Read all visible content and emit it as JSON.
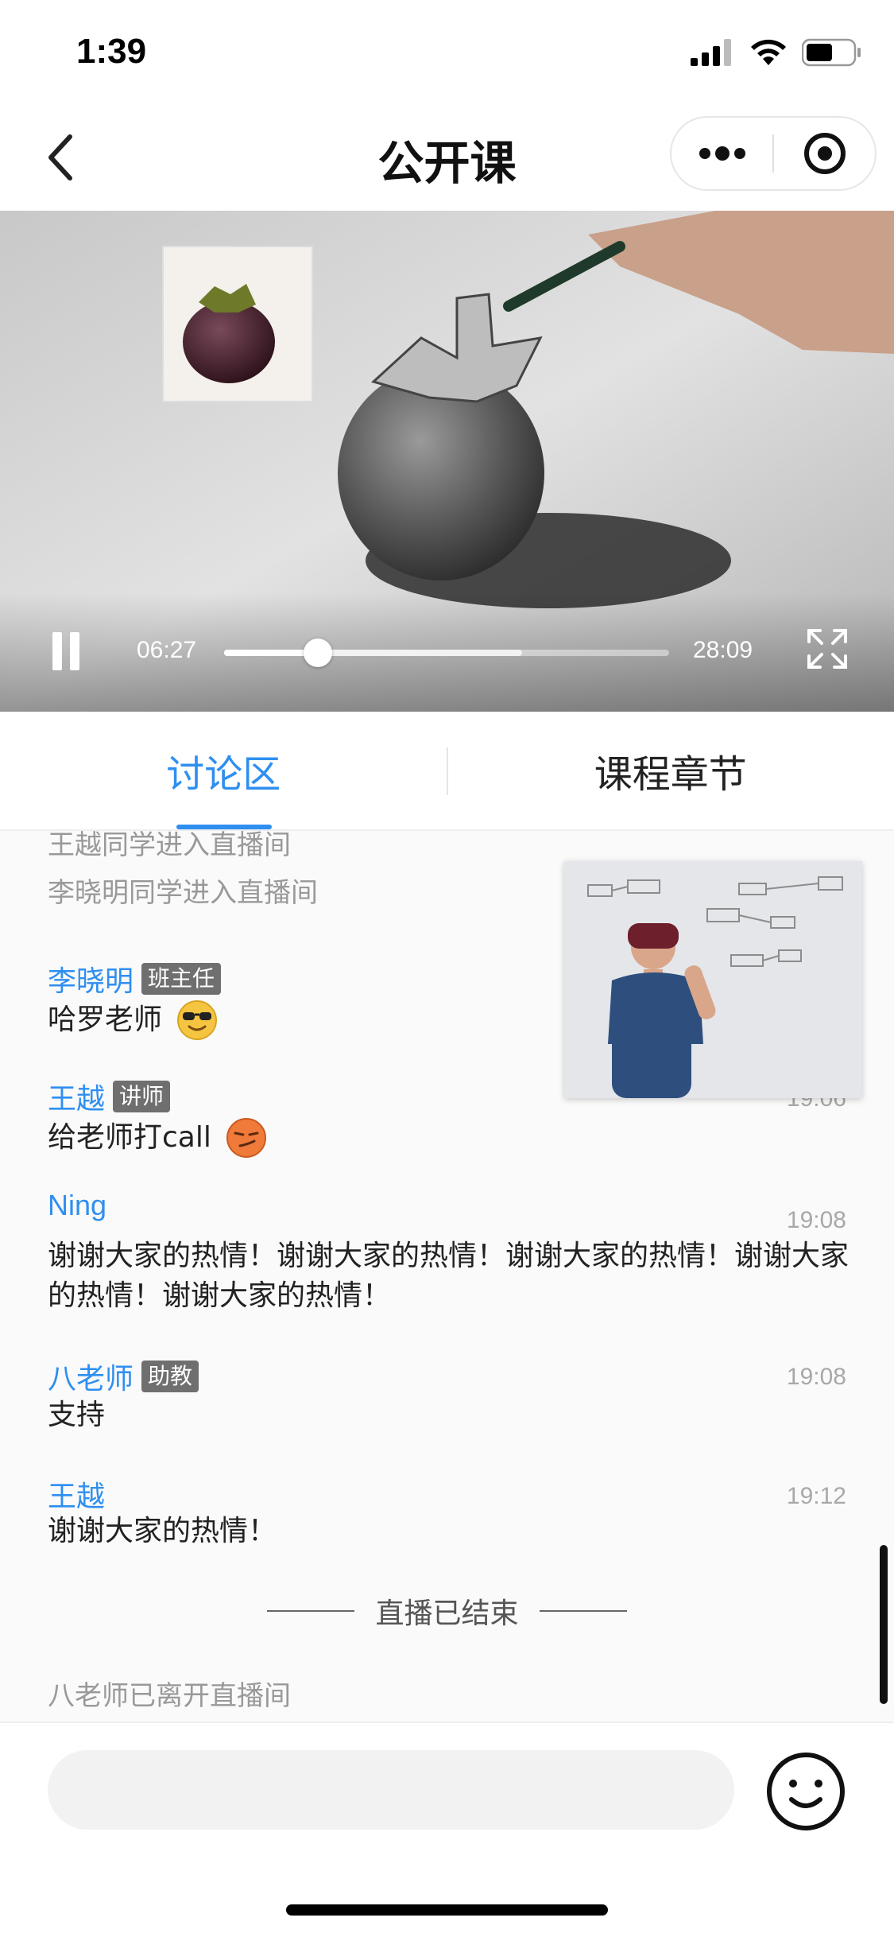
{
  "status_bar": {
    "time": "1:39"
  },
  "nav": {
    "title": "公开课"
  },
  "video": {
    "current_time": "06:27",
    "total_time": "28:09",
    "progress_fraction": 0.21,
    "buffered_fraction": 0.67
  },
  "tabs": [
    {
      "label": "讨论区",
      "active": true
    },
    {
      "label": "课程章节",
      "active": false
    }
  ],
  "chat": {
    "system_top_cut": "王越同学进入直播间",
    "system_join": "李晓明同学进入直播间",
    "messages": [
      {
        "name": "李晓明",
        "badge": "班主任",
        "time": "",
        "text": "哈罗老师",
        "emoji": "sunglasses-emoji"
      },
      {
        "name": "王越",
        "badge": "讲师",
        "time": "19:06",
        "text": "给老师打call",
        "emoji": "smirk-emoji"
      },
      {
        "name": "Ning",
        "badge": "",
        "time": "19:08",
        "text": "谢谢大家的热情！谢谢大家的热情！谢谢大家的热情！谢谢大家的热情！谢谢大家的热情！",
        "emoji": ""
      },
      {
        "name": "八老师",
        "badge": "助教",
        "time": "19:08",
        "text": "支持",
        "emoji": ""
      },
      {
        "name": "王越",
        "badge": "",
        "time": "19:12",
        "text": "谢谢大家的热情！",
        "emoji": ""
      }
    ],
    "ended_label": "直播已结束",
    "system_leave": "八老师已离开直播间"
  },
  "colors": {
    "accent": "#2f8ff0",
    "badge_bg": "#6f6f6f"
  },
  "icons": [
    "back-icon",
    "more-dots-icon",
    "close-target-icon",
    "pause-icon",
    "fullscreen-icon",
    "smiley-icon",
    "signal-icon",
    "wifi-icon",
    "battery-icon"
  ]
}
